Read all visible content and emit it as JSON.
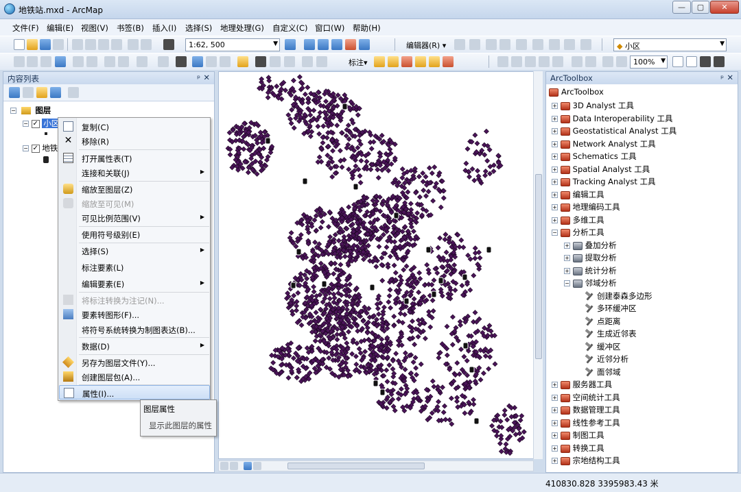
{
  "window": {
    "title": "地铁站.mxd - ArcMap",
    "minimize": "—",
    "maximize": "▢",
    "close": "✕"
  },
  "menubar": [
    "文件(F)",
    "编辑(E)",
    "视图(V)",
    "书签(B)",
    "插入(I)",
    "选择(S)",
    "地理处理(G)",
    "自定义(C)",
    "窗口(W)",
    "帮助(H)"
  ],
  "toolbar": {
    "scale_value": "1:62, 500",
    "editor_label": "编辑器(R) ▾",
    "layer_combo": "小区",
    "label_menu": "标注▾",
    "zoom_percent": "100%"
  },
  "toc": {
    "title": "内容列表",
    "pin": "ᵖ",
    "close": "✕",
    "root_label": "图层",
    "layer1_label": "小区",
    "layer2_label": "地铁"
  },
  "context_menu": {
    "items": [
      {
        "label": "复制(C)"
      },
      {
        "label": "移除(R)"
      },
      {
        "label": "打开属性表(T)"
      },
      {
        "label": "连接和关联(J)"
      },
      {
        "label": "缩放至图层(Z)"
      },
      {
        "label": "缩放至可见(M)"
      },
      {
        "label": "可见比例范围(V)"
      },
      {
        "label": "使用符号级别(E)"
      },
      {
        "label": "选择(S)"
      },
      {
        "label": "标注要素(L)"
      },
      {
        "label": "编辑要素(E)"
      },
      {
        "label": "将标注转换为注记(N)..."
      },
      {
        "label": "要素转图形(F)..."
      },
      {
        "label": "将符号系统转换为制图表达(B)..."
      },
      {
        "label": "数据(D)"
      },
      {
        "label": "另存为图层文件(Y)..."
      },
      {
        "label": "创建图层包(A)..."
      },
      {
        "label": "属性(I)..."
      }
    ]
  },
  "tooltip": {
    "title": "图层属性",
    "description": "显示此图层的属性"
  },
  "toolbox": {
    "title": "ArcToolbox",
    "root": "ArcToolbox",
    "items": [
      "3D Analyst 工具",
      "Data Interoperability 工具",
      "Geostatistical Analyst 工具",
      "Network Analyst 工具",
      "Schematics 工具",
      "Spatial Analyst 工具",
      "Tracking Analyst 工具",
      "编辑工具",
      "地理编码工具",
      "多维工具",
      "分析工具",
      "叠加分析",
      "提取分析",
      "统计分析",
      "邻域分析",
      "创建泰森多边形",
      "多环缓冲区",
      "点距离",
      "生成近邻表",
      "缓冲区",
      "近邻分析",
      "面邻域",
      "服务器工具",
      "空间统计工具",
      "数据管理工具",
      "线性参考工具",
      "制图工具",
      "转换工具",
      "宗地结构工具"
    ]
  },
  "statusbar": {
    "coordinates": "410830.828  3395983.43 米"
  },
  "map": {
    "point_color": "#4a1458",
    "station_color": "#111111"
  }
}
